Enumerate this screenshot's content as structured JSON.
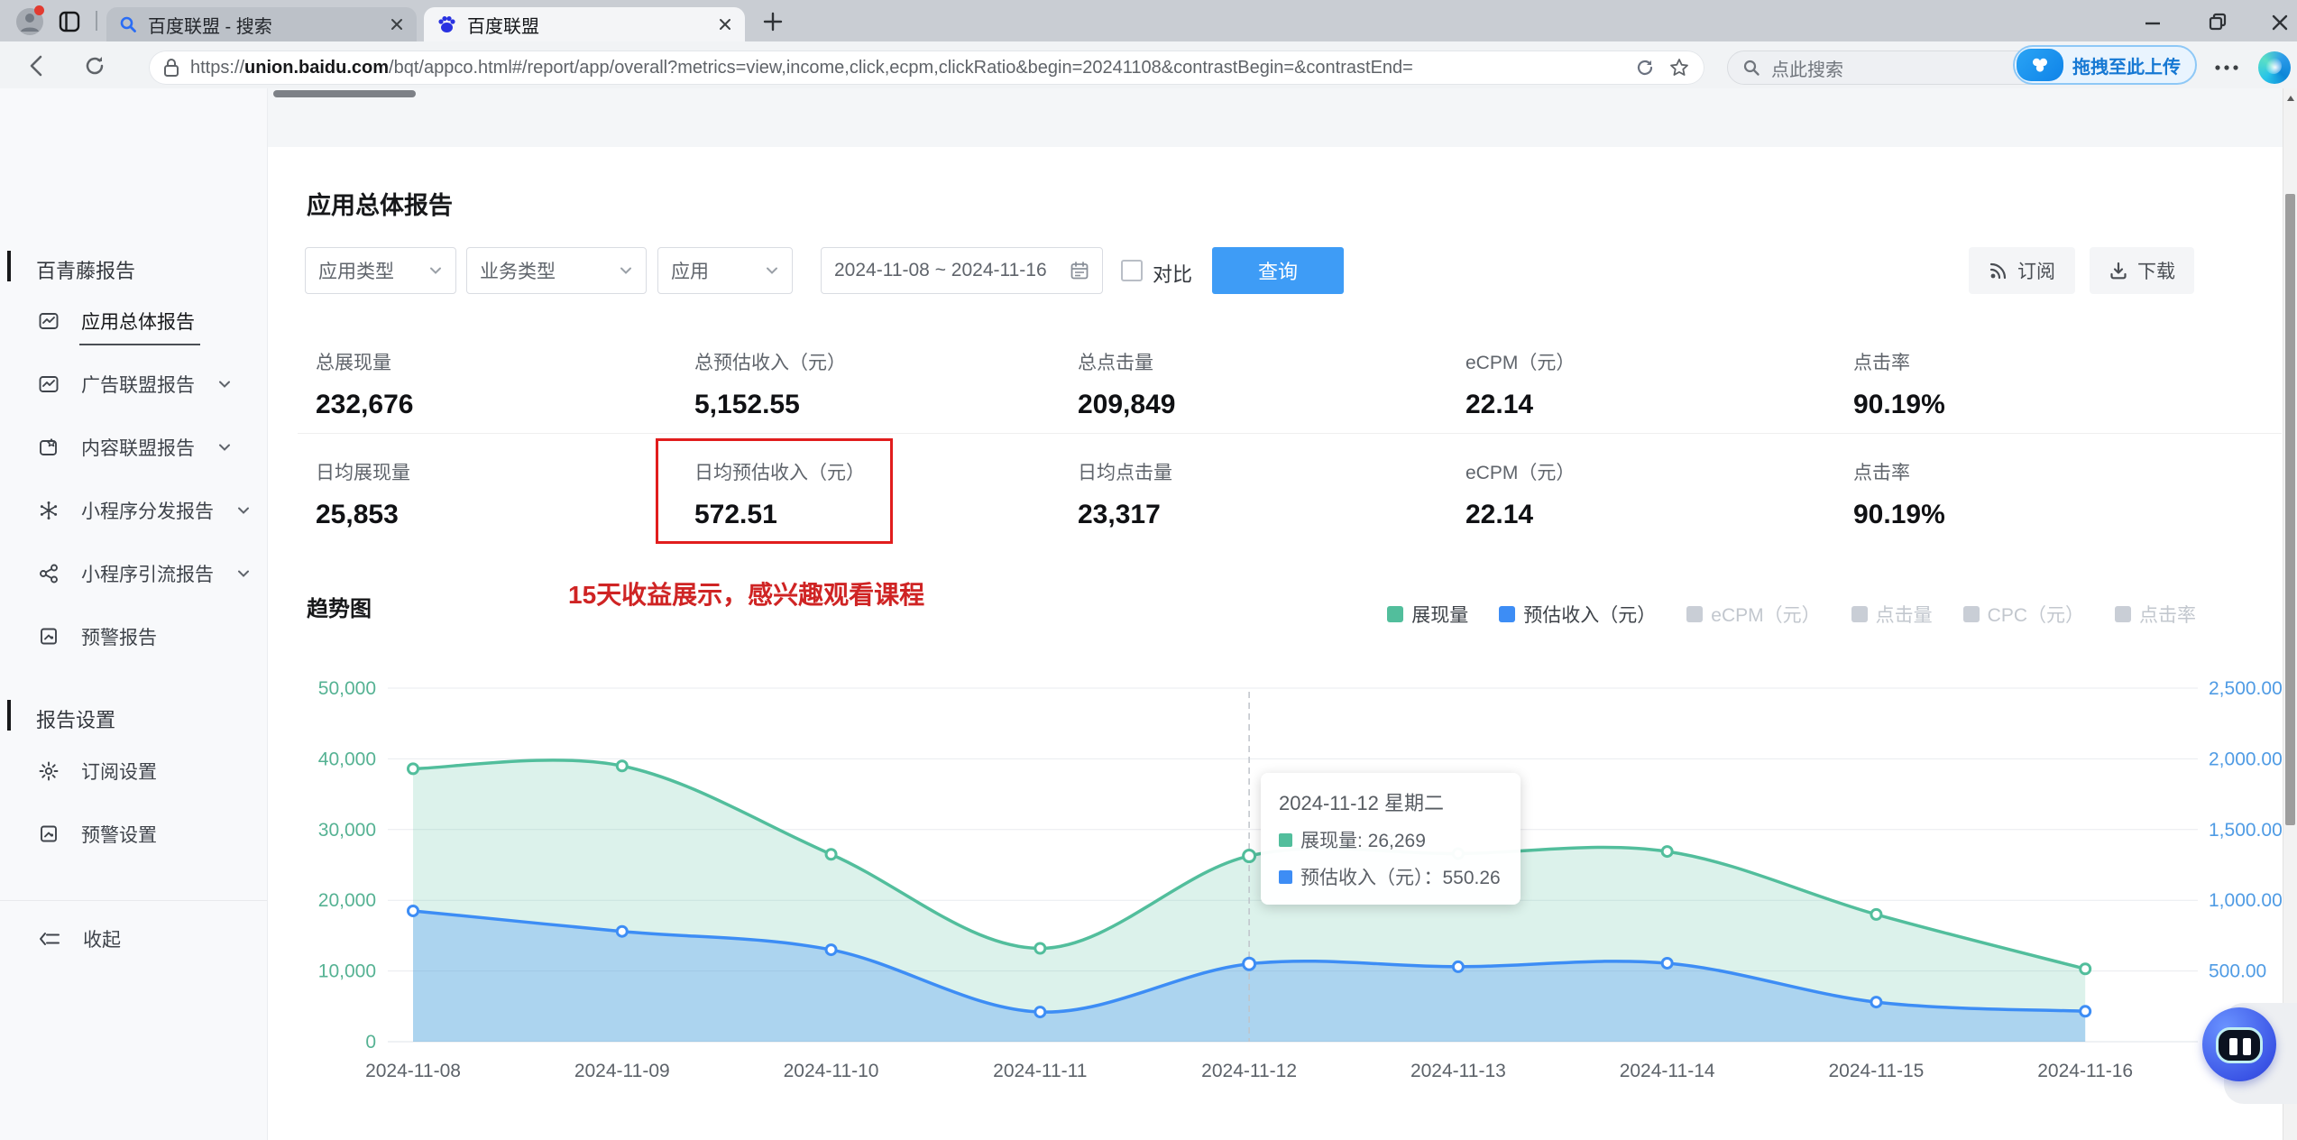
{
  "browser": {
    "tabs": [
      {
        "title": "百度联盟 - 搜索"
      },
      {
        "title": "百度联盟"
      }
    ],
    "url": {
      "scheme": "https://",
      "domain": "union.baidu.com",
      "path": "/bqt/appco.html#/report/app/overall?metrics=view,income,click,ecpm,clickRatio&begin=20241108&contrastBegin=&contrastEnd="
    },
    "search_placeholder": "点此搜索",
    "netdisk_button": "拖拽至此上传"
  },
  "sidebar": {
    "section_reports": "百青藤报告",
    "items": [
      {
        "label": "应用总体报告"
      },
      {
        "label": "广告联盟报告"
      },
      {
        "label": "内容联盟报告"
      },
      {
        "label": "小程序分发报告"
      },
      {
        "label": "小程序引流报告"
      },
      {
        "label": "预警报告"
      }
    ],
    "section_settings": "报告设置",
    "settings_items": [
      {
        "label": "订阅设置"
      },
      {
        "label": "预警设置"
      }
    ],
    "collapse": "收起"
  },
  "report": {
    "title": "应用总体报告",
    "filters": {
      "app_type": "应用类型",
      "biz_type": "业务类型",
      "app": "应用",
      "date_range": "2024-11-08 ~ 2024-11-16",
      "compare": "对比",
      "query": "查询",
      "query_color": "#3e9cf6"
    },
    "actions": {
      "subscribe": "订阅",
      "download": "下载"
    },
    "stats_total": [
      {
        "label": "总展现量",
        "value": "232,676"
      },
      {
        "label": "总预估收入（元）",
        "value": "5,152.55"
      },
      {
        "label": "总点击量",
        "value": "209,849"
      },
      {
        "label": "eCPM（元）",
        "value": "22.14"
      },
      {
        "label": "点击率",
        "value": "90.19%"
      }
    ],
    "stats_daily": [
      {
        "label": "日均展现量",
        "value": "25,853"
      },
      {
        "label": "日均预估收入（元）",
        "value": "572.51"
      },
      {
        "label": "日均点击量",
        "value": "23,317"
      },
      {
        "label": "eCPM（元）",
        "value": "22.14"
      },
      {
        "label": "点击率",
        "value": "90.19%"
      }
    ],
    "annotation": "15天收益展示，感兴趣观看课程"
  },
  "chart_data": {
    "type": "area",
    "title": "趋势图",
    "categories": [
      "2024-11-08",
      "2024-11-09",
      "2024-11-10",
      "2024-11-11",
      "2024-11-12",
      "2024-11-13",
      "2024-11-14",
      "2024-11-15",
      "2024-11-16"
    ],
    "series": [
      {
        "name": "展现量",
        "axis": "left",
        "color": "#52be9c",
        "fill": "rgba(82,190,156,0.20)",
        "values": [
          38600,
          39000,
          26500,
          13200,
          26269,
          26600,
          26900,
          18000,
          10300
        ]
      },
      {
        "name": "预估收入（元）",
        "axis": "right",
        "color": "#3d8df5",
        "fill": "rgba(62,142,247,0.30)",
        "values": [
          925,
          780,
          650,
          210,
          550.26,
          530,
          555,
          280,
          215
        ]
      }
    ],
    "legend": [
      {
        "label": "展现量",
        "color": "#52be9c",
        "active": true
      },
      {
        "label": "预估收入（元）",
        "color": "#3d8df5",
        "active": true
      },
      {
        "label": "eCPM（元）",
        "color": "#c9ced6",
        "active": false
      },
      {
        "label": "点击量",
        "color": "#c9ced6",
        "active": false
      },
      {
        "label": "CPC（元）",
        "color": "#c9ced6",
        "active": false
      },
      {
        "label": "点击率",
        "color": "#c9ced6",
        "active": false
      }
    ],
    "y_left": {
      "max": 50000,
      "ticks": [
        "50,000",
        "40,000",
        "30,000",
        "20,000",
        "10,000",
        "0"
      ],
      "color": "#55b293"
    },
    "y_right": {
      "max": 2500,
      "ticks": [
        "2,500.00",
        "2,000.00",
        "1,500.00",
        "1,000.00",
        "500.00",
        "0"
      ],
      "color": "#4f9be4"
    },
    "grid": true,
    "legend_position": "top-right",
    "tooltip": {
      "index": 4,
      "title": "2024-11-12 星期二",
      "rows": [
        {
          "label": "展现量",
          "sep": ": ",
          "value": "26,269",
          "color": "#52be9c"
        },
        {
          "label": "预估收入（元）",
          "sep": "：",
          "value": "550.26",
          "color": "#3d8df5"
        }
      ]
    }
  }
}
